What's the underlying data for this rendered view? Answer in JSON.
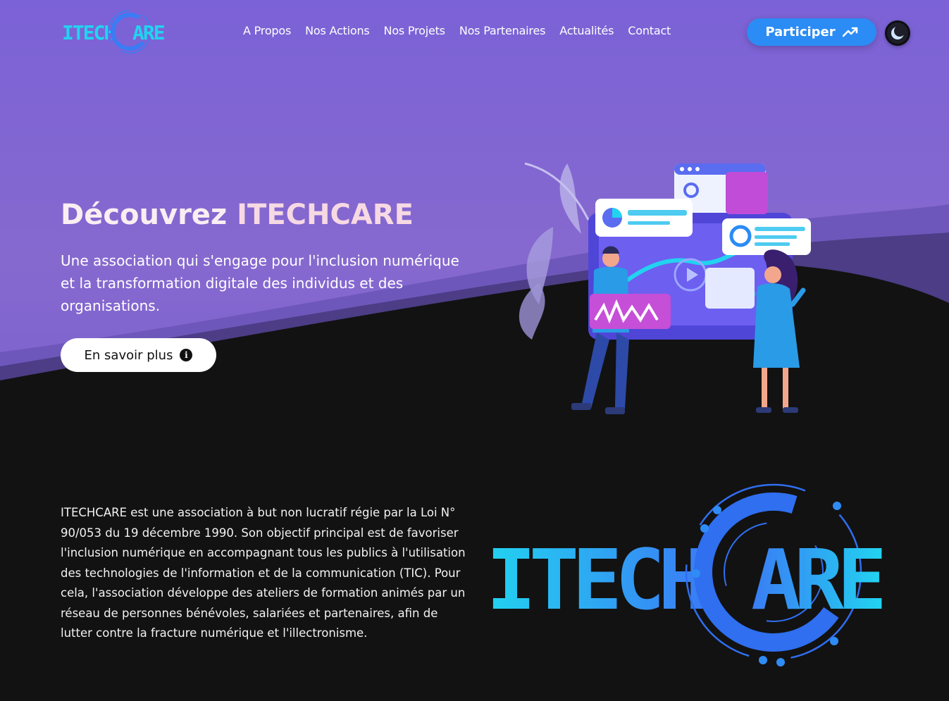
{
  "brand": {
    "logo_text_left": "ITECH",
    "logo_text_right": "ARE",
    "logo_letter_c": "C"
  },
  "nav": {
    "items": [
      {
        "label": "A Propos"
      },
      {
        "label": "Nos Actions"
      },
      {
        "label": "Nos Projets"
      },
      {
        "label": "Nos Partenaires"
      },
      {
        "label": "Actualités"
      },
      {
        "label": "Contact"
      }
    ],
    "cta_label": "Participer"
  },
  "hero": {
    "title_prefix": "Découvrez",
    "title_highlight": "ITECHCARE",
    "description": "Une association qui s'engage pour l'inclusion numérique et la transformation digitale des individus et des organisations.",
    "button_label": "En savoir plus",
    "button_icon_glyph": "i"
  },
  "about": {
    "text": "ITECHCARE est une association à but non lucratif régie par la Loi N° 90/053 du 19 décembre 1990. Son objectif principal est de favoriser l'inclusion numérique en accompagnant tous les publics à l'utilisation des technologies de l'information et de la communication (TIC). Pour cela, l'association développe des ateliers de formation animés par un réseau de personnes bénévoles, salariées et partenaires, afin de lutter contre la fracture numérique et l'illectronisme."
  },
  "colors": {
    "hero_bg": "#8066d2",
    "dark_bg": "#121212",
    "accent_blue": "#2b8cf5",
    "logo_cyan": "#22d3f0",
    "logo_blue": "#3a7cf5"
  },
  "icons": {
    "participer_icon": "trending-up-icon",
    "theme_icon": "moon-icon",
    "info_icon": "info-icon"
  }
}
